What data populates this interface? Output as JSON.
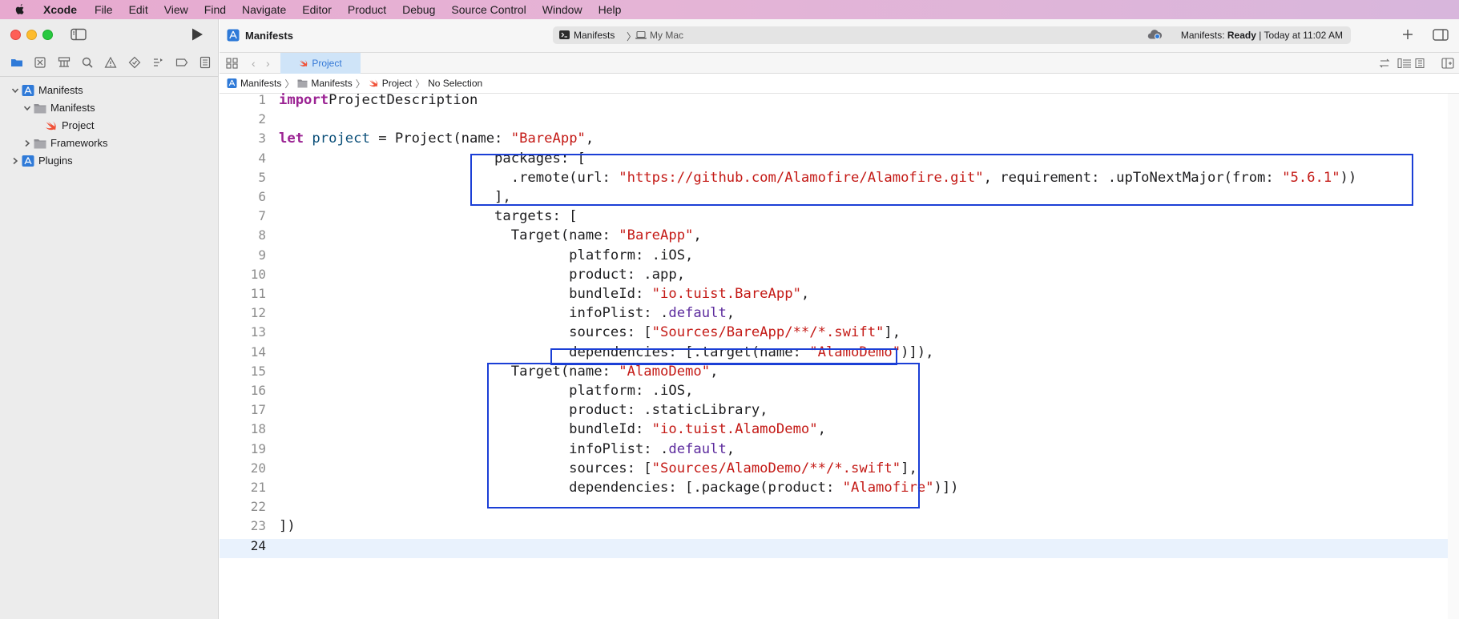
{
  "menubar": {
    "app": "Xcode",
    "items": [
      "File",
      "Edit",
      "View",
      "Find",
      "Navigate",
      "Editor",
      "Product",
      "Debug",
      "Source Control",
      "Window",
      "Help"
    ]
  },
  "toolbar": {
    "title": "Manifests",
    "scheme": "Manifests",
    "destination": "My Mac",
    "status_prefix": "Manifests:",
    "status_state": "Ready",
    "status_suffix": "| Today at 11:02 AM"
  },
  "tab": {
    "label": "Project"
  },
  "jumpbar": {
    "segments": [
      "Manifests",
      "Manifests",
      "Project",
      "No Selection"
    ]
  },
  "navigator": {
    "items": [
      {
        "label": "Manifests",
        "level": 0,
        "kind": "project",
        "expanded": true
      },
      {
        "label": "Manifests",
        "level": 1,
        "kind": "folder",
        "expanded": true
      },
      {
        "label": "Project",
        "level": 2,
        "kind": "swift",
        "expanded": null
      },
      {
        "label": "Frameworks",
        "level": 1,
        "kind": "folder",
        "expanded": false
      },
      {
        "label": "Plugins",
        "level": 0,
        "kind": "project",
        "expanded": false
      }
    ]
  },
  "editor": {
    "current_line": 24,
    "line_numbers": [
      "1",
      "2",
      "3",
      "4",
      "5",
      "6",
      "7",
      "8",
      "9",
      "10",
      "11",
      "12",
      "13",
      "14",
      "15",
      "16",
      "17",
      "18",
      "19",
      "20",
      "21",
      "22",
      "23",
      "24"
    ],
    "lines": [
      [
        [
          "kw",
          "import"
        ],
        [
          "",
          "ProjectDescription"
        ]
      ],
      [],
      [
        [
          "kw",
          "let"
        ],
        [
          "",
          " "
        ],
        [
          "tp",
          "project"
        ],
        [
          "",
          " = Project(name: "
        ],
        [
          "str",
          "\"BareApp\""
        ],
        [
          "",
          ","
        ]
      ],
      [
        [
          "",
          "                          packages: ["
        ]
      ],
      [
        [
          "",
          "                            .remote(url: "
        ],
        [
          "str",
          "\"https://github.com/Alamofire/Alamofire.git\""
        ],
        [
          "",
          ", requirement: .upToNextMajor(from: "
        ],
        [
          "str",
          "\"5.6.1\""
        ],
        [
          "",
          "))"
        ]
      ],
      [
        [
          "",
          "                          ],"
        ]
      ],
      [
        [
          "",
          "                          targets: ["
        ]
      ],
      [
        [
          "",
          "                            Target(name: "
        ],
        [
          "str",
          "\"BareApp\""
        ],
        [
          "",
          ","
        ]
      ],
      [
        [
          "",
          "                                   platform: .iOS,"
        ]
      ],
      [
        [
          "",
          "                                   product: .app,"
        ]
      ],
      [
        [
          "",
          "                                   bundleId: "
        ],
        [
          "str",
          "\"io.tuist.BareApp\""
        ],
        [
          "",
          ","
        ]
      ],
      [
        [
          "",
          "                                   infoPlist: ."
        ],
        [
          "en",
          "default"
        ],
        [
          "",
          ","
        ]
      ],
      [
        [
          "",
          "                                   sources: ["
        ],
        [
          "str",
          "\"Sources/BareApp/**/*.swift\""
        ],
        [
          "",
          "],"
        ]
      ],
      [
        [
          "",
          "                                   dependencies: [.target(name: "
        ],
        [
          "str",
          "\"AlamoDemo\""
        ],
        [
          "",
          ")]),"
        ]
      ],
      [
        [
          "",
          "                            Target(name: "
        ],
        [
          "str",
          "\"AlamoDemo\""
        ],
        [
          "",
          ","
        ]
      ],
      [
        [
          "",
          "                                   platform: .iOS,"
        ]
      ],
      [
        [
          "",
          "                                   product: .staticLibrary,"
        ]
      ],
      [
        [
          "",
          "                                   bundleId: "
        ],
        [
          "str",
          "\"io.tuist.AlamoDemo\""
        ],
        [
          "",
          ","
        ]
      ],
      [
        [
          "",
          "                                   infoPlist: ."
        ],
        [
          "en",
          "default"
        ],
        [
          "",
          ","
        ]
      ],
      [
        [
          "",
          "                                   sources: ["
        ],
        [
          "str",
          "\"Sources/AlamoDemo/**/*.swift\""
        ],
        [
          "",
          "],"
        ]
      ],
      [
        [
          "",
          "                                   dependencies: [.package(product: "
        ],
        [
          "str",
          "\"Alamofire\""
        ],
        [
          "",
          ")])"
        ]
      ],
      [],
      [
        [
          "",
          "])"
        ]
      ],
      []
    ]
  },
  "colors": {
    "keyword": "#9b2393",
    "string": "#c41a16",
    "type": "#0b4f79",
    "enum_member": "#5d2c9e",
    "highlight_box": "#1b3fd6",
    "current_line": "#e9f2fd"
  },
  "icons": [
    "apple-icon",
    "sidebar-toggle-icon",
    "run-icon",
    "folder-icon",
    "source-control-icon",
    "symbol-icon",
    "search-icon",
    "issue-icon",
    "test-icon",
    "debug-icon",
    "breakpoint-icon",
    "report-icon",
    "chevron-down-icon",
    "chevron-right-icon",
    "project-icon",
    "swift-icon",
    "terminal-icon",
    "mac-icon",
    "cloud-icon",
    "plus-icon",
    "inspector-toggle-icon",
    "grid-icon"
  ]
}
